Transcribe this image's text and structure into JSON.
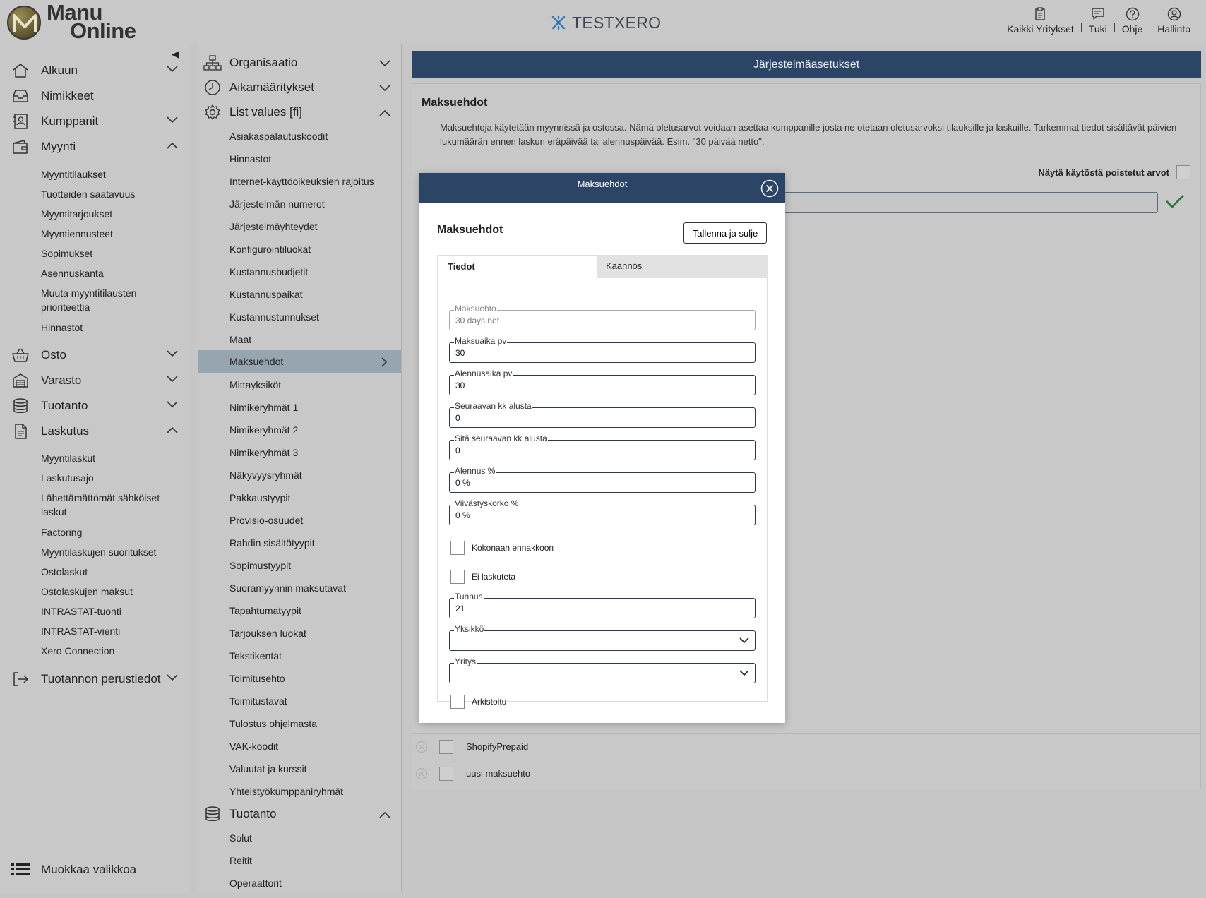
{
  "app": {
    "logo_line1": "Manu",
    "logo_line2": "Online",
    "company": "TESTXERO",
    "top_actions": [
      {
        "label": "Kaikki Yritykset",
        "icon": "clipboard-icon"
      },
      {
        "label": "Tuki",
        "icon": "chat-icon"
      },
      {
        "label": "Ohje",
        "icon": "help-icon"
      },
      {
        "label": "Hallinto",
        "icon": "user-icon"
      }
    ],
    "accent_color": "#2c4566"
  },
  "leftnav": {
    "items": [
      {
        "label": "Alkuun",
        "icon": "home-icon",
        "expanded": false
      },
      {
        "label": "Nimikkeet",
        "icon": "inbox-icon"
      },
      {
        "label": "Kumppanit",
        "icon": "contacts-icon",
        "expanded": false
      },
      {
        "label": "Myynti",
        "icon": "wallet-icon",
        "expanded": true
      },
      {
        "label": "Osto",
        "icon": "basket-icon",
        "expanded": false
      },
      {
        "label": "Varasto",
        "icon": "warehouse-icon",
        "expanded": false
      },
      {
        "label": "Tuotanto",
        "icon": "database-icon",
        "expanded": false
      },
      {
        "label": "Laskutus",
        "icon": "document-icon",
        "expanded": true
      },
      {
        "label": "Tuotannon perustiedot",
        "icon": "exit-icon",
        "expanded": false
      }
    ],
    "myynti_sub": [
      "Myyntitilaukset",
      "Tuotteiden saatavuus",
      "Myyntitarjoukset",
      "Myyntiennusteet",
      "Sopimukset",
      "Asennuskanta",
      "Muuta myyntitilausten prioriteettia",
      "Hinnastot"
    ],
    "laskutus_sub": [
      "Myyntilaskut",
      "Laskutusajo",
      "Lähettämättömät sähköiset laskut",
      "Factoring",
      "Myyntilaskujen suoritukset",
      "Ostolaskut",
      "Ostolaskujen maksut",
      "INTRASTAT-tuonti",
      "INTRASTAT-vienti",
      "Xero Connection"
    ],
    "bottom": "Muokkaa valikkoa"
  },
  "midnav": {
    "heads": [
      {
        "label": "Organisaatio",
        "icon": "org-chart-icon",
        "expanded": false
      },
      {
        "label": "Aikamääritykset",
        "icon": "clock-icon",
        "expanded": false
      },
      {
        "label": "List values [fi]",
        "icon": "gear-icon",
        "expanded": true
      },
      {
        "label": "Tuotanto",
        "icon": "database-icon",
        "expanded": true
      }
    ],
    "list_values": [
      "Asiakaspalautuskoodit",
      "Hinnastot",
      "Internet-käyttöoikeuksien rajoitus",
      "Järjestelmän numerot",
      "Järjestelmäyhteydet",
      "Konfigurointiluokat",
      "Kustannusbudjetit",
      "Kustannuspaikat",
      "Kustannustunnukset",
      "Maat",
      "Maksuehdot",
      "Mittayksiköt",
      "Nimikeryhmät 1",
      "Nimikeryhmät 2",
      "Nimikeryhmät 3",
      "Näkyvyysryhmät",
      "Pakkaustyypit",
      "Provisio-osuudet",
      "Rahdin sisältötyypit",
      "Sopimustyypit",
      "Suoramyynnin maksutavat",
      "Tapahtumatyypit",
      "Tarjouksen luokat",
      "Tekstikentät",
      "Toimitusehto",
      "Toimitustavat",
      "Tulostus ohjelmasta",
      "VAK-koodit",
      "Valuutat ja kurssit",
      "Yhteistyökumppaniryhmät"
    ],
    "selected": "Maksuehdot",
    "tuotanto_sub": [
      "Solut",
      "Reitit",
      "Operaattorit"
    ]
  },
  "main": {
    "header": "Järjestelmäasetukset",
    "title": "Maksuehdot",
    "description": "Maksuehtoja käytetään myynnissä ja ostossa. Nämä oletusarvot voidaan asettaa kumppanille josta ne otetaan oletusarvoksi tilauksille ja laskuille. Tarkemmat tiedot sisältävät päivien lukumäärän ennen laskun eräpäivää tai alennuspäivää. Esim. \"30 päivää netto\".",
    "show_deleted": "Näytä käytöstä poistetut arvot",
    "rows": [
      "ShopifyPrepaid",
      "uusi maksuehto"
    ]
  },
  "modal": {
    "header": "Maksuehdot",
    "title": "Maksuehdot",
    "save_label": "Tallenna ja sulje",
    "tabs": [
      "Tiedot",
      "Käännös"
    ],
    "fields": [
      {
        "label": "Maksuehto",
        "value": "30 days net",
        "disabled": true
      },
      {
        "label": "Maksuaika pv",
        "value": "30"
      },
      {
        "label": "Alennusaika pv",
        "value": "30"
      },
      {
        "label": "Seuraavan kk alusta",
        "value": "0"
      },
      {
        "label": "Sitä seuraavan kk alusta",
        "value": "0"
      },
      {
        "label": "Alennus %",
        "value": "0 %"
      },
      {
        "label": "Viivästyskorko %",
        "value": "0 %"
      }
    ],
    "checks": [
      "Kokonaan ennakkoon",
      "Ei laskuteta"
    ],
    "tunnus": {
      "label": "Tunnus",
      "value": "21"
    },
    "selects": [
      {
        "label": "Yksikkö",
        "value": ""
      },
      {
        "label": "Yritys",
        "value": ""
      }
    ],
    "archived": "Arkistoitu"
  }
}
